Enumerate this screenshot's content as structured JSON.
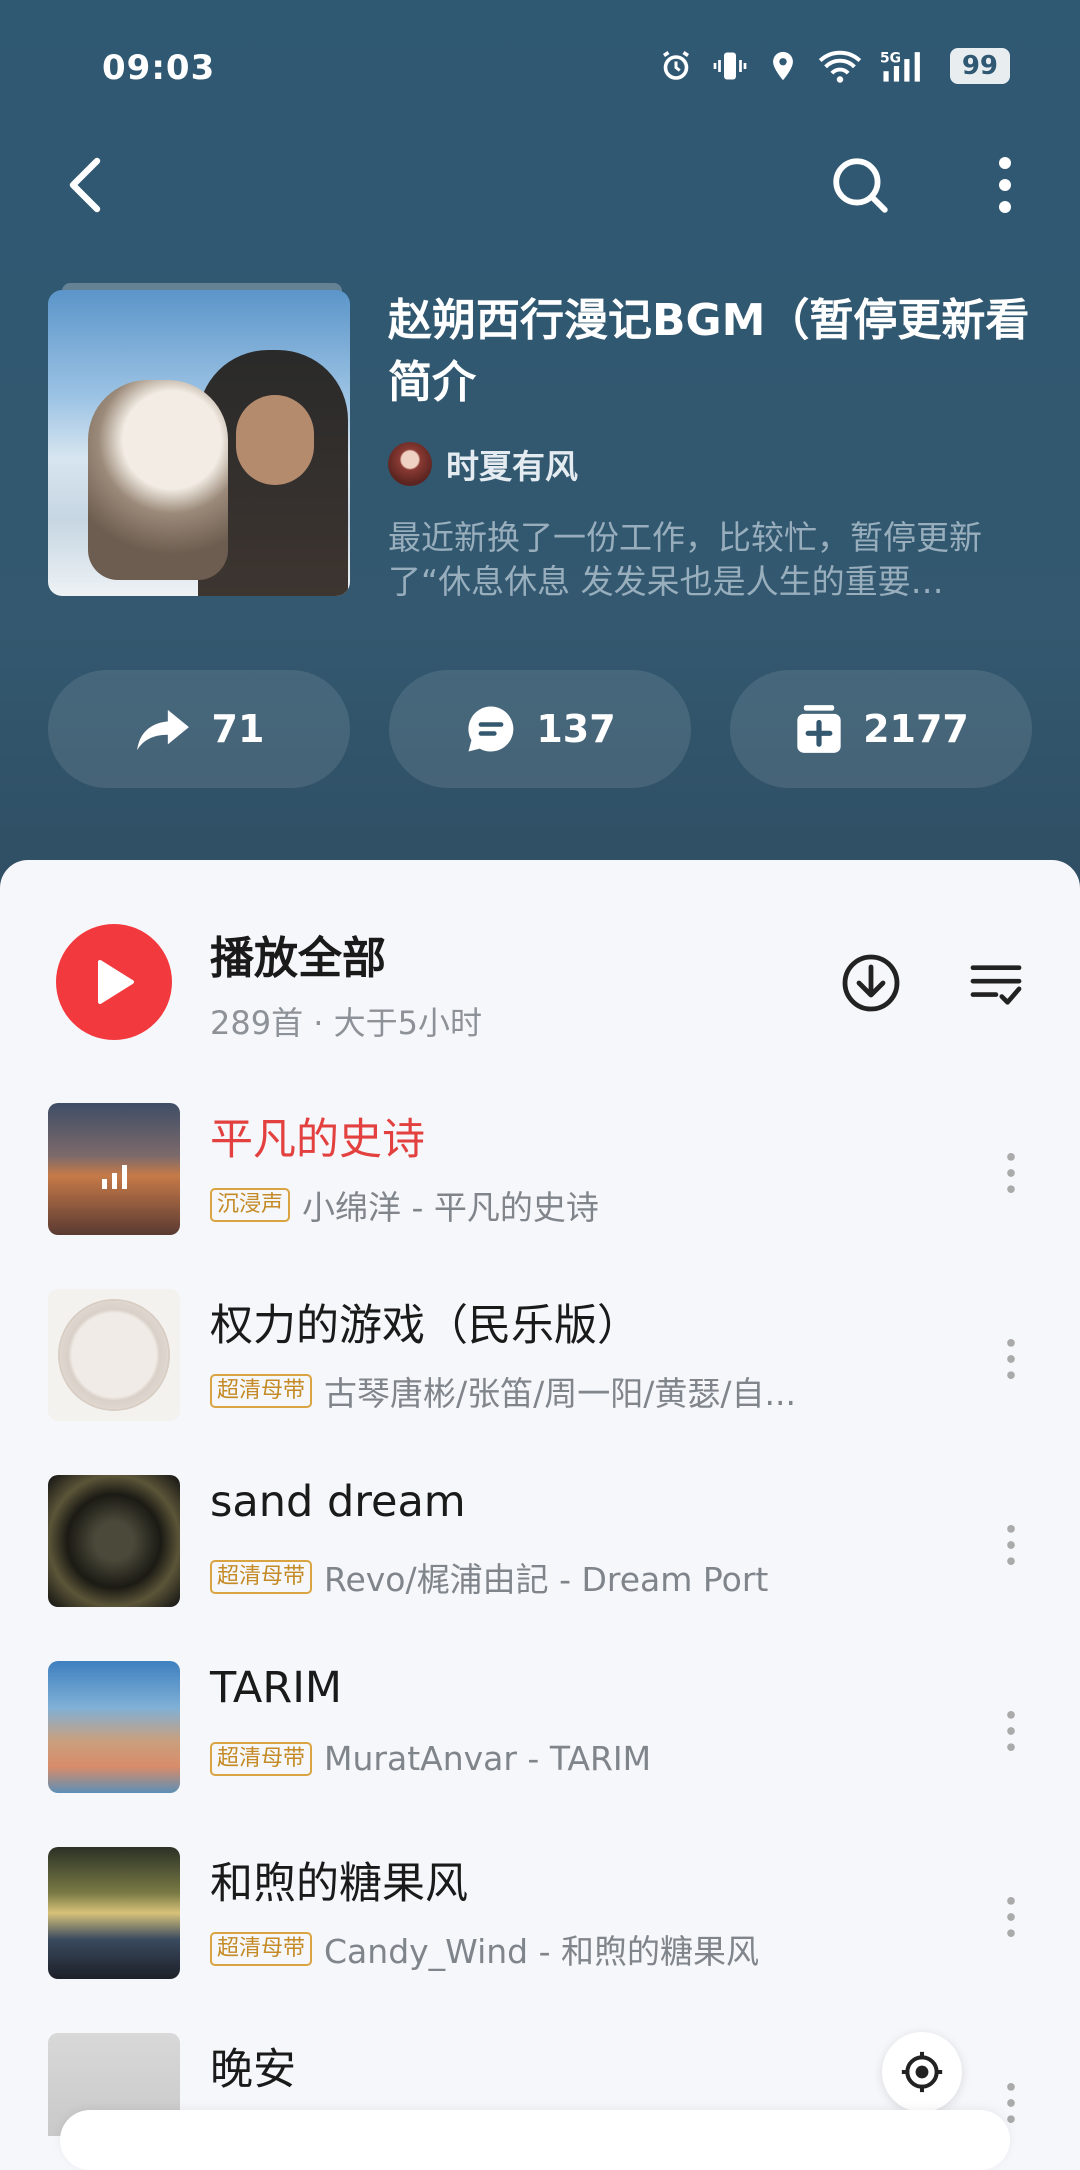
{
  "status_bar": {
    "time": "09:03",
    "battery": "99"
  },
  "playlist": {
    "title": "赵朔西行漫记BGM（暂停更新看简介",
    "creator": "时夏有风",
    "description": "最近新换了一份工作，比较忙，暂停更新了“休息休息 发发呆也是人生的重要…"
  },
  "actions": {
    "share_count": "71",
    "comment_count": "137",
    "collect_count": "2177"
  },
  "play_all": {
    "label": "播放全部",
    "subtitle": "289首 · 大于5小时"
  },
  "songs": [
    {
      "title": "平凡的史诗",
      "badge": "沉浸声",
      "artist": "小绵洋 - 平凡的史诗",
      "playing": true
    },
    {
      "title": "权力的游戏（民乐版）",
      "badge": "超清母带",
      "artist": "古琴唐彬/张笛/周一阳/黄瑟/自..."
    },
    {
      "title": "sand dream",
      "badge": "超清母带",
      "artist": "Revo/梶浦由記 - Dream Port"
    },
    {
      "title": "TARIM",
      "badge": "超清母带",
      "artist": "MuratAnvar - TARIM"
    },
    {
      "title": "和煦的糖果风",
      "badge": "超清母带",
      "artist": "Candy_Wind - 和煦的糖果风"
    },
    {
      "title": "晚安"
    }
  ],
  "colors": {
    "header_bg": "#2f5873",
    "accent_red": "#f2393d",
    "playing_title": "#e2413f",
    "badge": "#c48a25"
  }
}
